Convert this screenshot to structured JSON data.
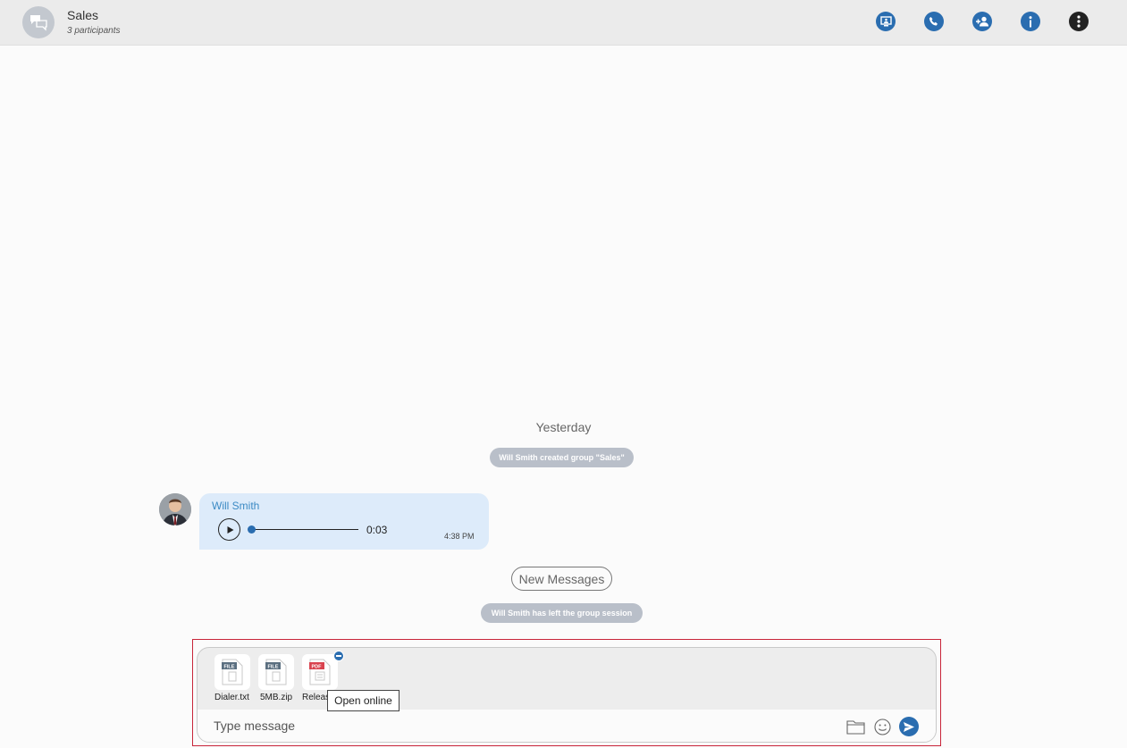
{
  "header": {
    "title": "Sales",
    "subtitle": "3 participants",
    "icons": [
      "chat-bubbles-icon",
      "screen-share-icon",
      "phone-icon",
      "add-person-icon",
      "info-icon",
      "more-vertical-icon"
    ]
  },
  "conversation": {
    "day_label": "Yesterday",
    "created_notice": "Will Smith created group \"Sales\"",
    "message": {
      "sender": "Will Smith",
      "duration": "0:03",
      "time": "4:38 PM",
      "progress": 0
    },
    "new_messages_label": "New Messages",
    "left_notice": "Will Smith has left the group session"
  },
  "composer": {
    "attachments": [
      {
        "name": "Dialer.txt",
        "badge": "FILE",
        "badge_color": "#5b6f80"
      },
      {
        "name": "5MB.zip",
        "badge": "FILE",
        "badge_color": "#5b6f80"
      },
      {
        "name": "Releas",
        "badge": "PDF",
        "badge_color": "#d9434f"
      }
    ],
    "placeholder": "Type message",
    "tooltip": "Open online"
  },
  "colors": {
    "accent": "#2a6db0",
    "bubble": "#ddebfa",
    "pill": "#b9bfc9",
    "highlight_border": "#c8253a"
  }
}
